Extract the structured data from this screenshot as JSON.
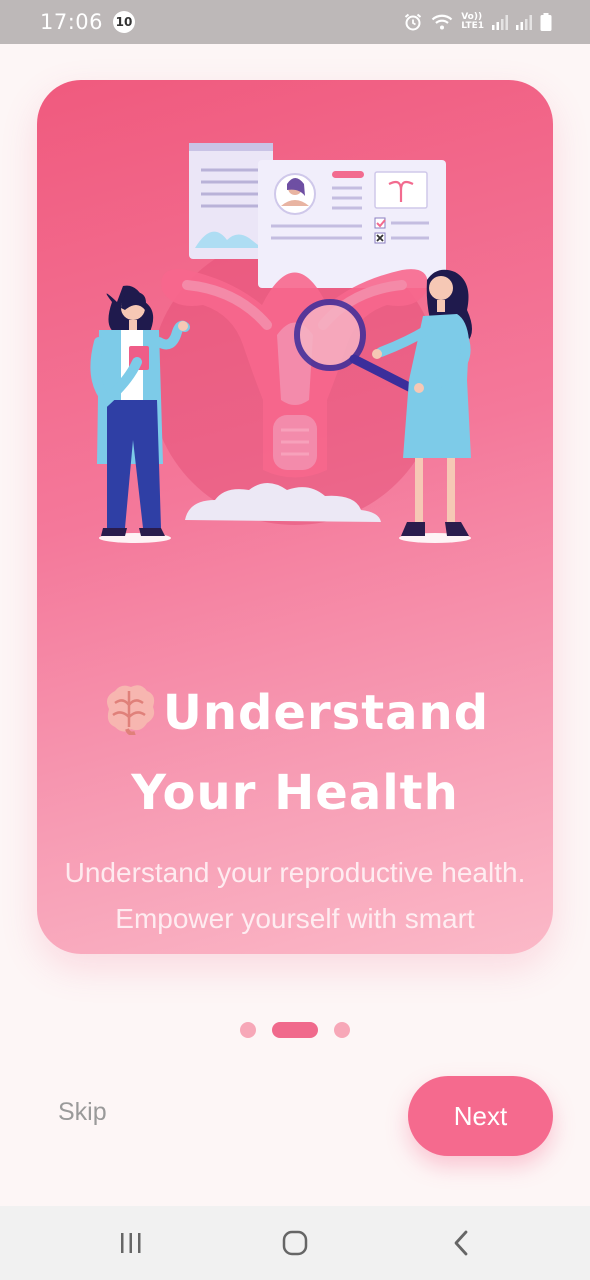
{
  "status_bar": {
    "time": "17:06",
    "notification_count": "10",
    "network_label_top": "Vo))",
    "network_label_bottom": "LTE1",
    "icons": [
      "alarm-icon",
      "wifi-icon",
      "signal-icon",
      "signal-icon",
      "battery-icon"
    ]
  },
  "onboarding": {
    "emoji": "🧠",
    "title_line1": "Understand",
    "title_line2": "Your Health",
    "description": "Understand your reproductive health. Empower yourself with smart gynecological insights.",
    "page_count": 3,
    "current_page": 2
  },
  "actions": {
    "skip_label": "Skip",
    "next_label": "Next"
  },
  "colors": {
    "accent": "#f56a8e",
    "card_top": "#f05a7e",
    "card_bottom": "#fbb9c8",
    "dot_inactive": "#f7a8b8"
  },
  "nav_bar": {
    "icons": [
      "recent-apps-icon",
      "home-icon",
      "back-icon"
    ]
  }
}
